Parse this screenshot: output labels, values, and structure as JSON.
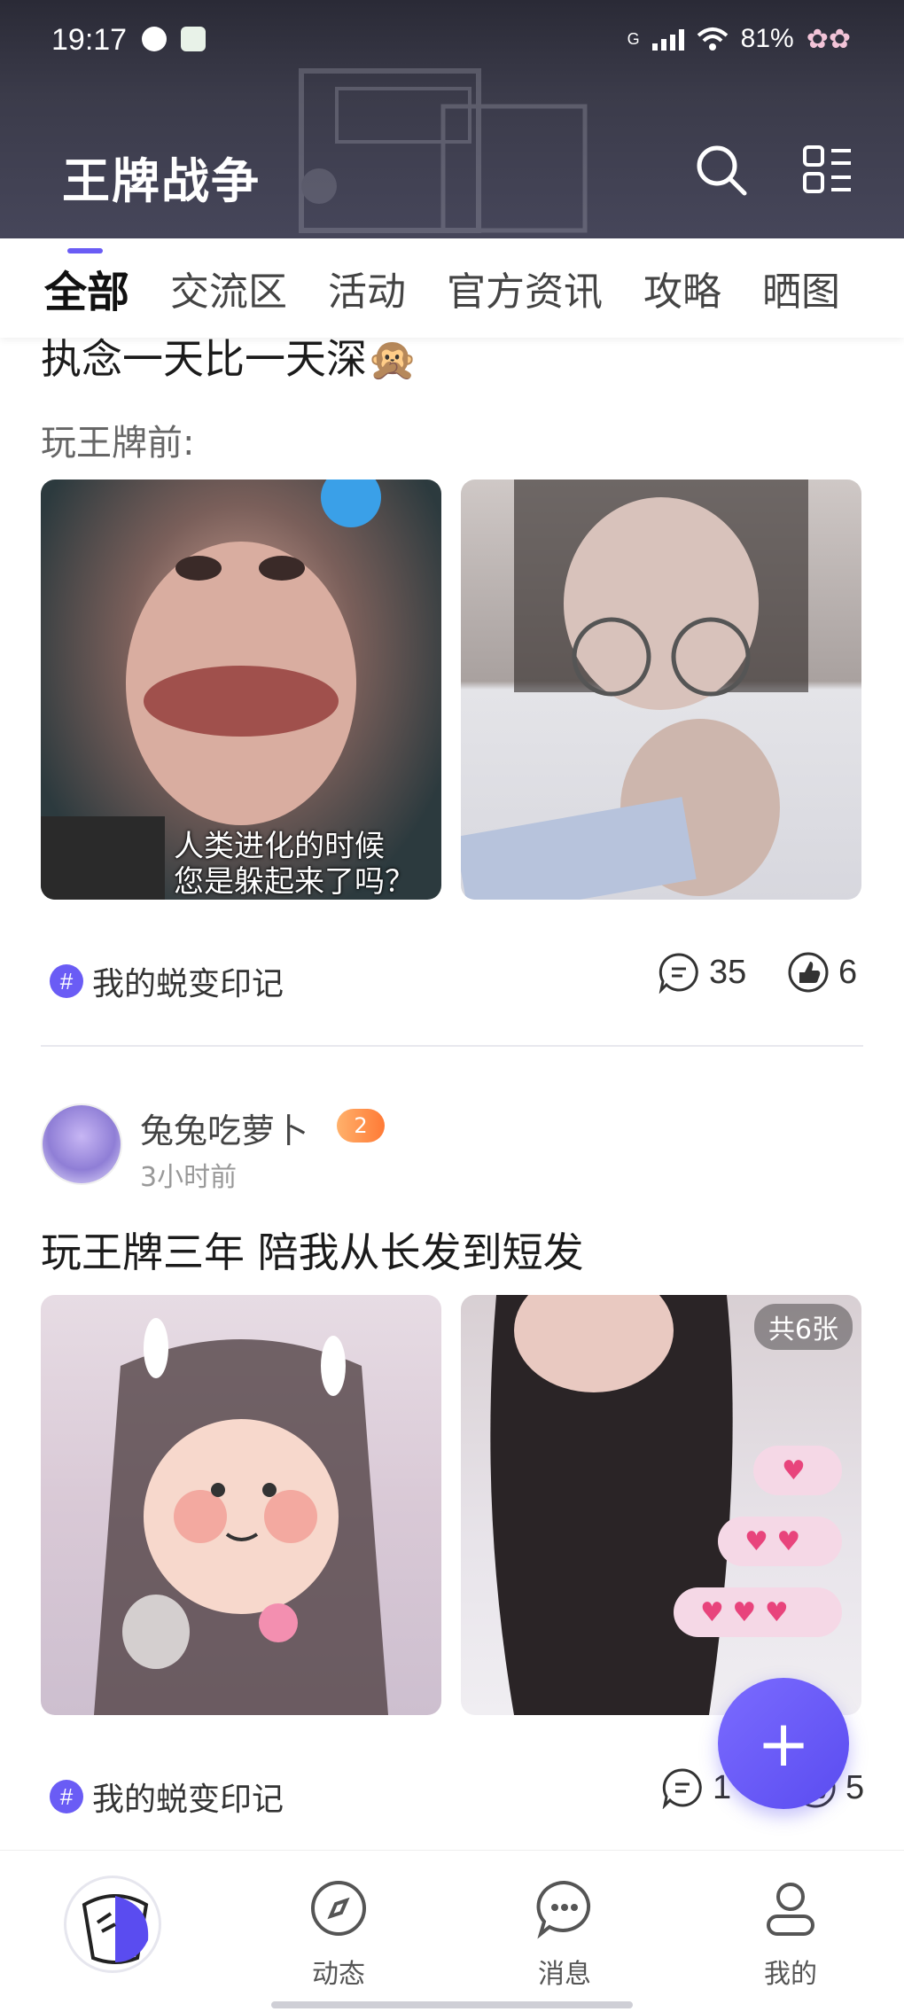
{
  "status_bar": {
    "time": "19:17",
    "network": "G",
    "battery": "81%"
  },
  "header": {
    "title": "王牌战争",
    "search_icon": "search-icon",
    "menu_icon": "grid-list-icon"
  },
  "tabs": [
    {
      "label": "全部",
      "active": true
    },
    {
      "label": "交流区",
      "active": false
    },
    {
      "label": "活动",
      "active": false
    },
    {
      "label": "官方资讯",
      "active": false
    },
    {
      "label": "攻略",
      "active": false
    },
    {
      "label": "晒图",
      "active": false
    }
  ],
  "posts": [
    {
      "title": "执念一天比一天深🙊",
      "subtitle": "玩王牌前:",
      "images": [
        {
          "caption": "人类进化的时候\n您是躲起来了吗？"
        },
        {
          "caption": ""
        }
      ],
      "topic": "我的蜕变印记",
      "comments": "35",
      "likes": "6"
    },
    {
      "author": "兔兔吃萝卜",
      "level": "2",
      "time": "3小时前",
      "title": "玩王牌三年  陪我从长发到短发",
      "images": [
        {
          "caption": ""
        },
        {
          "count_label": "共6张"
        }
      ],
      "topic": "我的蜕变印记",
      "comments": "1",
      "likes": "5"
    }
  ],
  "fab": {
    "label": "+"
  },
  "bottom_nav": [
    {
      "label": "",
      "icon": "home-logo-icon"
    },
    {
      "label": "动态",
      "icon": "compass-icon"
    },
    {
      "label": "消息",
      "icon": "chat-bubble-icon"
    },
    {
      "label": "我的",
      "icon": "profile-icon"
    }
  ],
  "colors": {
    "accent": "#6a5cf5",
    "header_bg": "#3b3b4a"
  }
}
